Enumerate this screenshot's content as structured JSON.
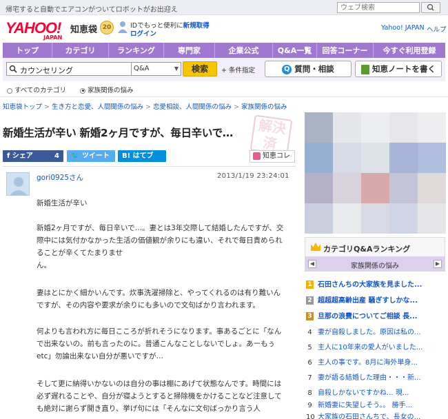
{
  "topbar": {
    "promo": "帰宅すると自動でエアコンがついてロボットがお出迎え",
    "search_placeholder": "ウェブ検索"
  },
  "header": {
    "logo": "YAHOO!",
    "logo_sub": "JAPAN",
    "chiebukuro": "知恵袋",
    "badge": "20",
    "id_line_pre": "IDでもっと便利に",
    "id_line_link": "新規取得",
    "login": "ログイン",
    "yahoo_japan": "Yahoo! JAPAN",
    "help": "ヘルプ"
  },
  "nav": {
    "items": [
      "トップ",
      "カテゴリ",
      "ランキング",
      "専門家",
      "企業公式",
      "Q&A一覧",
      "回答コーナー",
      "今すぐ利用登録"
    ]
  },
  "search": {
    "query": "カウンセリング",
    "type": "Q&A",
    "submit": "検索",
    "conditions": "+ 条件指定",
    "ask_button": "質問・相談",
    "note_button": "知恵ノートを書く",
    "scope_all": "すべてのカテゴリ",
    "scope_current": "家族関係の悩み"
  },
  "breadcrumb": [
    "知恵袋トップ",
    "生き方と恋愛、人間関係の悩み",
    "恋愛相談、人間関係の悩み",
    "家族関係の悩み"
  ],
  "question": {
    "title": "新婚生活が辛い 新婚2ヶ月ですが、毎日辛いで…",
    "stamp_text": "解決済",
    "share_fb": "シェア",
    "share_fb_count": "4",
    "share_tw": "ツイート",
    "share_hb": "はてブ",
    "chiekore": "知恵コレ",
    "user": "gori0925さん",
    "date": "2013/1/19 23:24:01",
    "paragraphs": [
      "新婚生活が辛い",
      "新婚2ヶ月ですが、毎日辛いで…。妻とは3年交際して結婚したんですが、交際中には気付かなかった生活の価値観が余りにも違い、それで毎日責められることが辛くてたまりませ\nん。",
      "妻はとにかく細かいんです。炊事洗濯掃除と、やってくれるのは有り難いんですが、その内容や要求が余りにも多いので文句ばかり言われます。",
      "何よりも言われ方に毎日こころが折れそうになります。事あるごとに「なんで出来ないの。前も言ったのに。普通こんなことしないでしょ。あーもぅetc」勿論出来ない自分が悪いですが…",
      "そして更に納得いかないのは自分の事は棚にあげて状態なんです。時間には必ず遅れることや、自分が寝ようとすると掃除機をかけることなど注意しても絶対に謝らず開き直り、挙げ句には「そんなに文句ばっかり言う人"
    ]
  },
  "ranking": {
    "title": "カテゴリQ&Aランキング",
    "category": "家族関係の悩み",
    "prev": "◀",
    "next": "▶",
    "items": [
      {
        "rank": "1",
        "text": "石田さんちの大家族を見ました..."
      },
      {
        "rank": "2",
        "text": "超超超高齢出産 騒ぎすしかな..."
      },
      {
        "rank": "3",
        "text": "旦那の浪費についてご相談 長..."
      },
      {
        "rank": "4",
        "text": "妻が自殺しました。原因は私の..."
      },
      {
        "rank": "5",
        "text": "主人に10年来の愛人がいました..."
      },
      {
        "rank": "6",
        "text": "主人の事です。8月に海外単身..."
      },
      {
        "rank": "7",
        "text": "妻が語る結婚した理由・・・新..."
      },
      {
        "rank": "8",
        "text": "自殺しかないですかね… 現..."
      },
      {
        "rank": "9",
        "text": "新婚妻に失望しそう。。 勝手..."
      },
      {
        "rank": "10",
        "text": "大家族の石田さんちで、長女の..."
      }
    ]
  },
  "colors": {
    "nav": "#a078d0",
    "accent_yellow": "#f7c400",
    "rank1": "#f0b400",
    "rank2": "#9a9a9a",
    "rank3": "#c8902c",
    "facebook": "#3b5998",
    "twitter": "#55acee",
    "hatena": "#008fde"
  }
}
